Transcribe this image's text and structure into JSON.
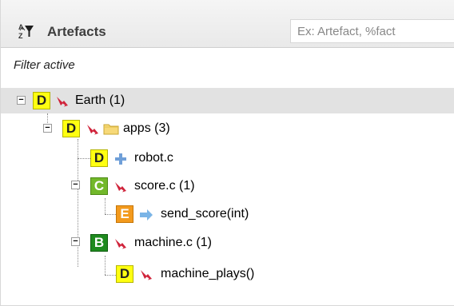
{
  "header": {
    "title": "Artefacts",
    "search_placeholder": "Ex: Artefact, %fact"
  },
  "filter_status": "Filter active",
  "tree": [
    {
      "badge": "D",
      "icon": "red-arrow-icon",
      "label": "Earth (1)",
      "toggle": "−",
      "selected": true
    },
    {
      "badge": "D",
      "icon": "red-arrow-icon",
      "folder": "folder-icon",
      "label": "apps (3)",
      "toggle": "−"
    },
    {
      "badge": "D",
      "icon": "blue-plus-icon",
      "label": "robot.c"
    },
    {
      "badge": "C",
      "icon": "red-arrow-icon",
      "label": "score.c (1)",
      "toggle": "−"
    },
    {
      "badge": "E",
      "icon": "blue-right-arrow-icon",
      "label": "send_score(int)"
    },
    {
      "badge": "B",
      "icon": "red-arrow-icon",
      "label": "machine.c (1)",
      "toggle": "−"
    },
    {
      "badge": "D",
      "icon": "red-arrow-icon",
      "label": "machine_plays()"
    }
  ],
  "colors": {
    "badge_d": "#ffff11",
    "badge_c": "#72b82a",
    "badge_e": "#f39a1d",
    "badge_b": "#1f8a1f",
    "selected_row": "#e2e2e2"
  }
}
